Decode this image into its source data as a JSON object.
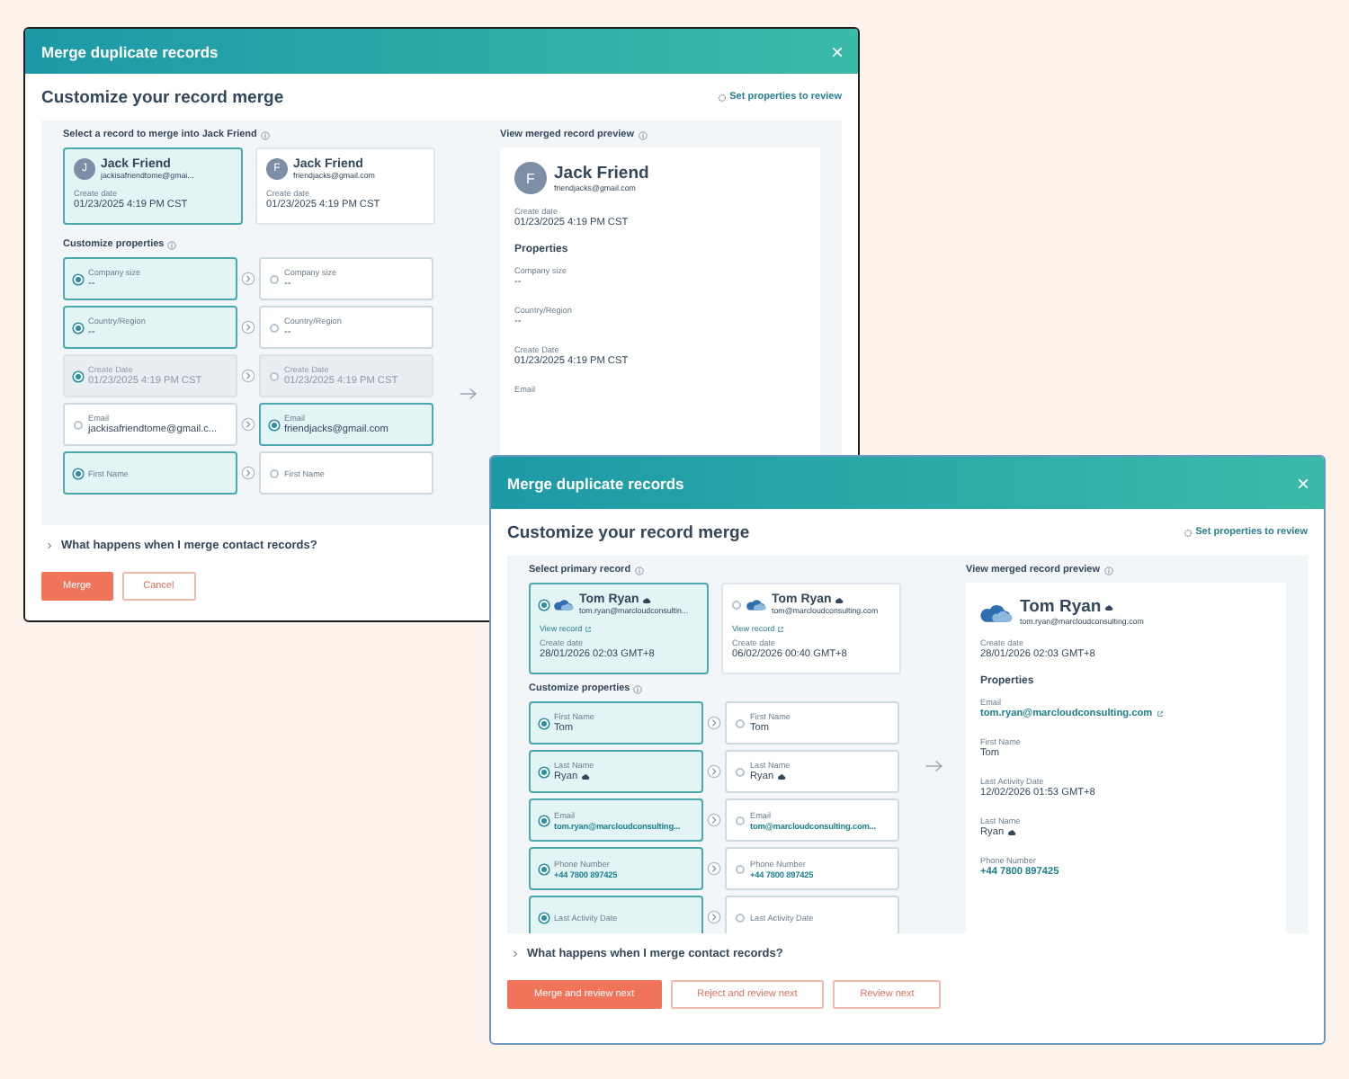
{
  "windows": [
    {
      "title": "Merge duplicate records",
      "close": "×",
      "heading": "Customize your record merge",
      "review_link": "Set properties to review",
      "select_label": "Select a record to merge into Jack Friend",
      "record_radios": false,
      "records": [
        {
          "kind": "letter",
          "avatar": "J",
          "name": "Jack Friend",
          "email": "jackisafriendtome@gmai...",
          "date_label": "Create date",
          "date": "01/23/2025 4:19 PM CST",
          "selected": true
        },
        {
          "kind": "letter",
          "avatar": "F",
          "name": "Jack Friend",
          "email": "friendjacks@gmail.com",
          "date_label": "Create date",
          "date": "01/23/2025 4:19 PM CST",
          "selected": false
        }
      ],
      "properties_label": "Customize properties",
      "property_rows": [
        {
          "left": {
            "label": "Company size",
            "value": "--",
            "selected": true,
            "disabled": false
          },
          "right": {
            "label": "Company size",
            "value": "--",
            "selected": false,
            "disabled": false
          }
        },
        {
          "left": {
            "label": "Country/Region",
            "value": "--",
            "selected": true,
            "disabled": false
          },
          "right": {
            "label": "Country/Region",
            "value": "--",
            "selected": false,
            "disabled": false
          }
        },
        {
          "left": {
            "label": "Create Date",
            "value": "01/23/2025 4:19 PM CST",
            "selected": true,
            "disabled": true
          },
          "right": {
            "label": "Create Date",
            "value": "01/23/2025 4:19 PM CST",
            "selected": false,
            "disabled": true
          }
        },
        {
          "left": {
            "label": "Email",
            "value": "jackisafriendtome@gmail.c...",
            "selected": false,
            "disabled": false
          },
          "right": {
            "label": "Email",
            "value": "friendjacks@gmail.com",
            "selected": true,
            "disabled": false
          }
        },
        {
          "left": {
            "label": "First Name",
            "selected": true,
            "disabled": false
          },
          "right": {
            "label": "First Name",
            "selected": false,
            "disabled": false
          }
        }
      ],
      "preview_label": "View merged record preview",
      "preview": {
        "kind": "letter",
        "avatar": "F",
        "name": "Jack Friend",
        "email": "friendjacks@gmail.com",
        "date_label": "Create date",
        "date": "01/23/2025 4:19 PM CST",
        "properties_title": "Properties",
        "fields": [
          {
            "label": "Company size",
            "value": "--"
          },
          {
            "label": "Country/Region",
            "value": "--"
          },
          {
            "label": "Create Date",
            "value": "01/23/2025 4:19 PM CST"
          },
          {
            "label": "Email"
          }
        ]
      },
      "question": "What happens when I merge contact records?",
      "buttons": [
        {
          "label": "Merge",
          "kind": "primary"
        },
        {
          "label": "Cancel",
          "kind": "secondary"
        }
      ]
    },
    {
      "title": "Merge duplicate records",
      "close": "×",
      "heading": "Customize your record merge",
      "review_link": "Set properties to review",
      "select_label": "Select primary record",
      "record_radios": true,
      "records": [
        {
          "kind": "logo",
          "name": "Tom Ryan",
          "synced": true,
          "email": "tom.ryan@marcloudconsultin...",
          "view_link": "View record",
          "date_label": "Create date",
          "date": "28/01/2026 02:03 GMT+8",
          "selected": true
        },
        {
          "kind": "logo",
          "name": "Tom Ryan",
          "synced": true,
          "email": "tom@marcloudconsulting.com",
          "view_link": "View record",
          "date_label": "Create date",
          "date": "06/02/2026 00:40 GMT+8",
          "selected": false
        }
      ],
      "properties_label": "Customize properties",
      "property_rows": [
        {
          "left": {
            "label": "First Name",
            "value": "Tom",
            "selected": true,
            "disabled": false
          },
          "right": {
            "label": "First Name",
            "value": "Tom",
            "selected": false,
            "disabled": false
          }
        },
        {
          "left": {
            "label": "Last Name",
            "value": "Ryan",
            "synced": true,
            "selected": true,
            "disabled": false
          },
          "right": {
            "label": "Last Name",
            "value": "Ryan",
            "synced": true,
            "selected": false,
            "disabled": false
          }
        },
        {
          "left": {
            "label": "Email",
            "value": "tom.ryan@marcloudconsulting...",
            "link": true,
            "selected": true,
            "disabled": false
          },
          "right": {
            "label": "Email",
            "value": "tom@marcloudconsulting.com...",
            "link": true,
            "selected": false,
            "disabled": false
          }
        },
        {
          "left": {
            "label": "Phone Number",
            "value": "+44 7800 897425",
            "link": true,
            "selected": true,
            "disabled": false
          },
          "right": {
            "label": "Phone Number",
            "value": "+44 7800 897425",
            "link": true,
            "selected": false,
            "disabled": false
          }
        },
        {
          "left": {
            "label": "Last Activity Date",
            "selected": true,
            "disabled": false
          },
          "right": {
            "label": "Last Activity Date",
            "selected": false,
            "disabled": false
          }
        }
      ],
      "preview_label": "View merged record preview",
      "preview": {
        "kind": "logo",
        "name": "Tom Ryan",
        "synced": true,
        "email": "tom.ryan@marcloudconsulting.com",
        "date_label": "Create date",
        "date": "28/01/2026 02:03 GMT+8",
        "properties_title": "Properties",
        "fields": [
          {
            "label": "Email",
            "value": "tom.ryan@marcloudconsulting.com",
            "link": true,
            "external": true
          },
          {
            "label": "First Name",
            "value": "Tom"
          },
          {
            "label": "Last Activity Date",
            "value": "12/02/2026 01:53 GMT+8"
          },
          {
            "label": "Last Name",
            "value": "Ryan",
            "synced": true
          },
          {
            "label": "Phone Number",
            "value": "+44 7800 897425",
            "link": true
          }
        ]
      },
      "question": "What happens when I merge contact records?",
      "buttons": [
        {
          "label": "Merge and review next",
          "kind": "primary"
        },
        {
          "label": "Reject and review next",
          "kind": "secondary"
        },
        {
          "label": "Review next",
          "kind": "secondary"
        }
      ]
    }
  ]
}
